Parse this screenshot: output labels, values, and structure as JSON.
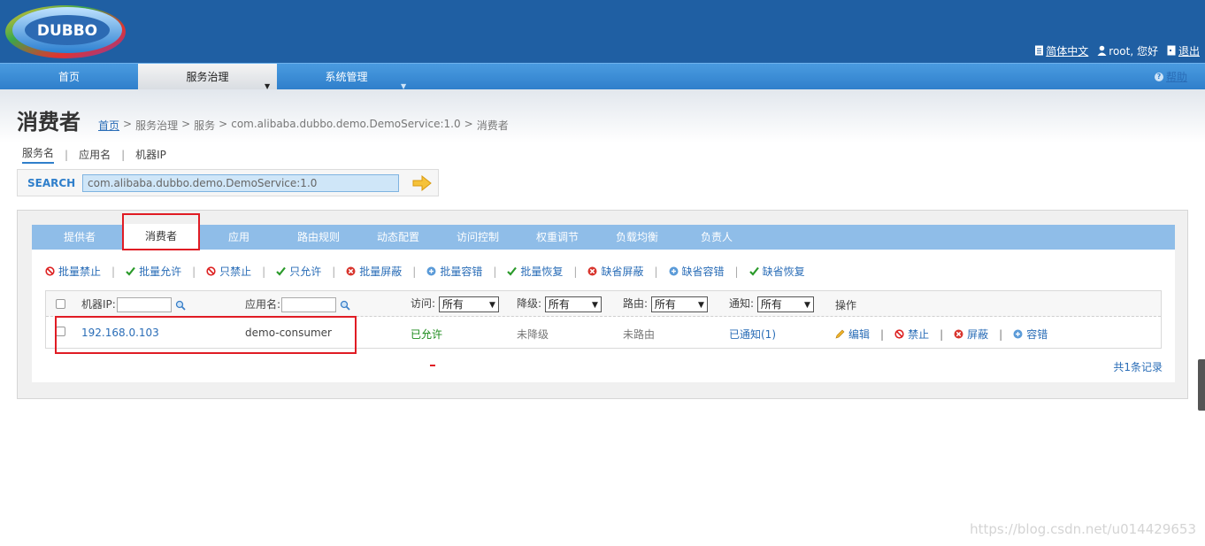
{
  "header": {
    "logo_text": "DUBBO",
    "language": "简体中文",
    "user": "root, 您好",
    "logout": "退出"
  },
  "nav": {
    "tabs": [
      {
        "label": "首页"
      },
      {
        "label": "服务治理",
        "active": true
      },
      {
        "label": "系统管理"
      }
    ],
    "help": "帮助"
  },
  "page": {
    "title": "消费者",
    "breadcrumb": [
      "首页",
      "服务治理",
      "服务",
      "com.alibaba.dubbo.demo.DemoService:1.0",
      "消费者"
    ],
    "breadcrumb_sep": ">"
  },
  "search": {
    "tabs": [
      "服务名",
      "应用名",
      "机器IP"
    ],
    "label": "SEARCH",
    "value": "com.alibaba.dubbo.demo.DemoService:1.0"
  },
  "tabs": [
    "提供者",
    "消费者",
    "应用",
    "路由规则",
    "动态配置",
    "访问控制",
    "权重调节",
    "负载均衡",
    "负责人"
  ],
  "actions": [
    "批量禁止",
    "批量允许",
    "只禁止",
    "只允许",
    "批量屏蔽",
    "批量容错",
    "批量恢复",
    "缺省屏蔽",
    "缺省容错",
    "缺省恢复"
  ],
  "table": {
    "headers": {
      "ip": "机器IP:",
      "app": "应用名:",
      "access": "访问:",
      "degrade": "降级:",
      "route": "路由:",
      "notify": "通知:",
      "ops": "操作"
    },
    "filter_all": "所有",
    "rows": [
      {
        "ip": "192.168.0.103",
        "app": "demo-consumer",
        "access": "已允许",
        "degrade": "未降级",
        "route": "未路由",
        "notify": "已通知(1)",
        "ops": [
          "编辑",
          "禁止",
          "屏蔽",
          "容错"
        ]
      }
    ],
    "count": "共1条记录"
  },
  "watermark": "https://blog.csdn.net/u014429653",
  "colors": {
    "header": "#1f5fa3",
    "nav": "#2f7fcb",
    "tabbar": "#8fbde8",
    "link": "#2a6db7",
    "highlight": "#e01c24"
  }
}
